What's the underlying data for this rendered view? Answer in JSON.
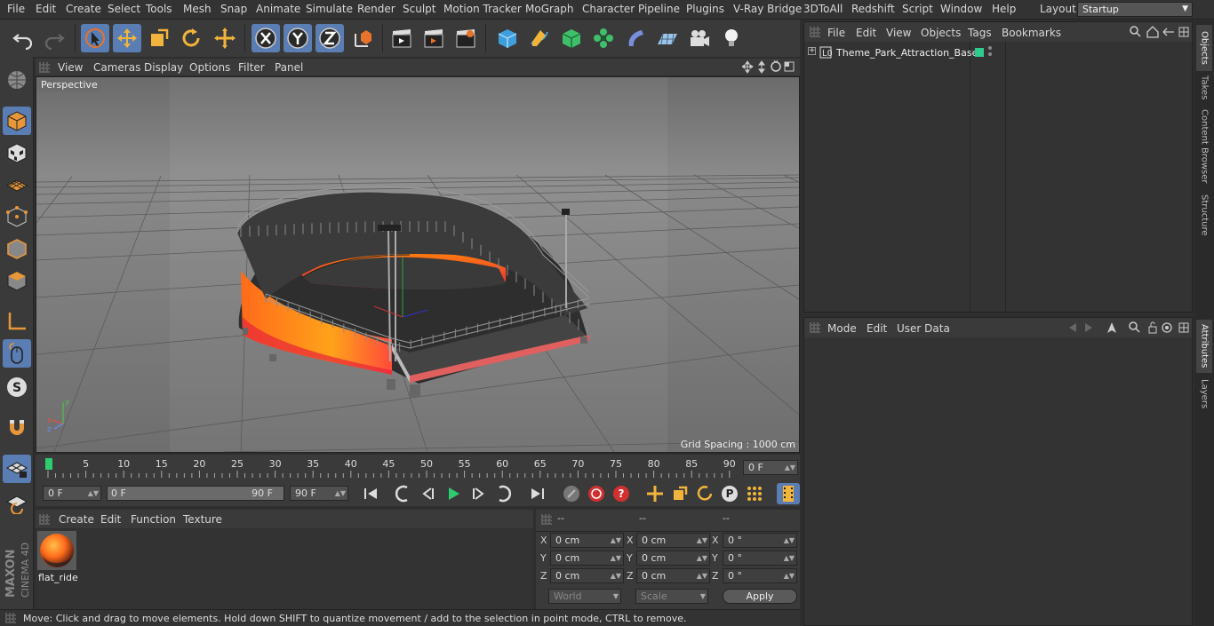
{
  "menubar": {
    "items": [
      "File",
      "Edit",
      "Create",
      "Select",
      "Tools",
      "Mesh",
      "Snap",
      "Animate",
      "Simulate",
      "Render",
      "Sculpt",
      "Motion Tracker",
      "MoGraph",
      "Character",
      "Pipeline",
      "Plugins",
      "V-Ray Bridge",
      "3DToAll",
      "Redshift",
      "Script",
      "Window",
      "Help"
    ],
    "layout_label": "Layout:",
    "layout_value": "Startup"
  },
  "viewport": {
    "menu": [
      "View",
      "Cameras",
      "Display",
      "Options",
      "Filter",
      "Panel"
    ],
    "label": "Perspective",
    "grid_spacing": "Grid Spacing : 1000 cm"
  },
  "timeline": {
    "ticks": [
      "0",
      "5",
      "10",
      "15",
      "20",
      "25",
      "30",
      "35",
      "40",
      "45",
      "50",
      "55",
      "60",
      "65",
      "70",
      "75",
      "80",
      "85",
      "90"
    ],
    "current_frame": "0 F"
  },
  "transport": {
    "start_field": "0 F",
    "range_start": "0 F",
    "range_end": "90 F",
    "end_field": "90 F"
  },
  "material_manager": {
    "menu": [
      "Create",
      "Edit",
      "Function",
      "Texture"
    ],
    "materials": [
      {
        "name": "flat_ride"
      }
    ]
  },
  "coordinates": {
    "headers": [
      "--",
      "--",
      "--"
    ],
    "rows": [
      {
        "axis": "X",
        "pos": "0 cm",
        "size_axis": "X",
        "size": "0 cm",
        "rot_axis": "X",
        "rot": "0 °"
      },
      {
        "axis": "Y",
        "pos": "0 cm",
        "size_axis": "Y",
        "size": "0 cm",
        "rot_axis": "Y",
        "rot": "0 °"
      },
      {
        "axis": "Z",
        "pos": "0 cm",
        "size_axis": "Z",
        "size": "0 cm",
        "rot_axis": "Z",
        "rot": "0 °"
      }
    ],
    "mode_select": "World",
    "scale_select": "Scale",
    "apply_label": "Apply"
  },
  "statusbar": {
    "text": "Move: Click and drag to move elements. Hold down SHIFT to quantize movement / add to the selection in point mode, CTRL to remove."
  },
  "object_manager": {
    "menu": [
      "File",
      "Edit",
      "View",
      "Objects",
      "Tags",
      "Bookmarks"
    ],
    "objects": [
      {
        "name": "Theme_Park_Attraction_Base",
        "layer_color": "#2ecc8f"
      }
    ]
  },
  "attribute_manager": {
    "menu": [
      "Mode",
      "Edit",
      "User Data"
    ]
  },
  "right_tabs": [
    "Objects",
    "Takes",
    "Content Browser",
    "Structure",
    "Attributes",
    "Layers"
  ],
  "logo": {
    "line1": "MAXON",
    "line2": "CINEMA 4D"
  },
  "colors": {
    "accent": "#5a7db3",
    "selected_tab": "#444444"
  }
}
